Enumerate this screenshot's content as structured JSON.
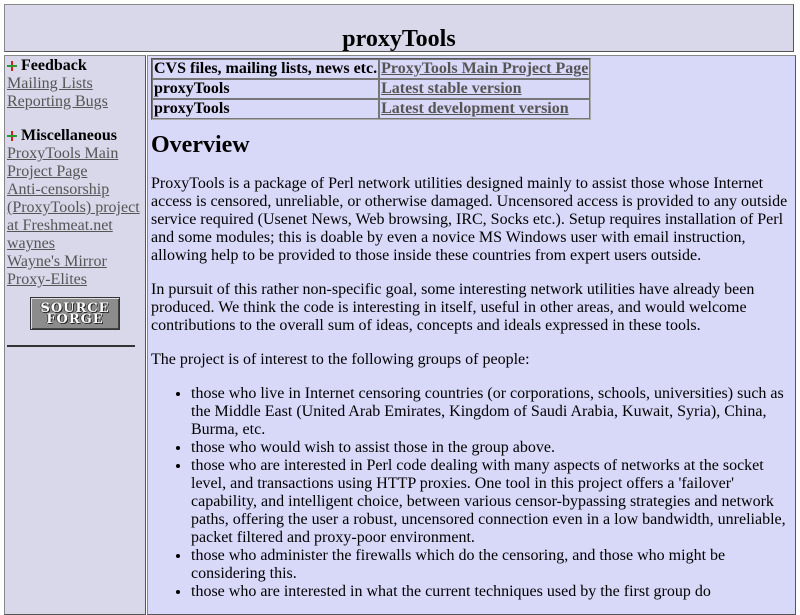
{
  "header": {
    "title": "proxyTools"
  },
  "sidebar": {
    "feedback": {
      "heading": "Feedback",
      "icon": "plus-bullet-icon",
      "links": [
        "Mailing Lists",
        "Reporting Bugs"
      ]
    },
    "misc": {
      "heading": "Miscellaneous",
      "icon": "plus-bullet-icon",
      "links": [
        "ProxyTools Main Project Page",
        "Anti-censorship (ProxyTools) project at Freshmeat.net",
        "waynes",
        "Wayne's Mirror",
        "Proxy-Elites"
      ]
    },
    "logo_text": "SOURCE FORGE"
  },
  "info_table": {
    "rows": [
      {
        "label": "CVS files, mailing lists, news etc.",
        "link": "ProxyTools Main Project Page"
      },
      {
        "label": "proxyTools",
        "link": "Latest stable version"
      },
      {
        "label": "proxyTools",
        "link": "Latest development version"
      }
    ]
  },
  "content": {
    "heading": "Overview",
    "para1": "ProxyTools is a package of Perl network utilities designed mainly to assist those whose Internet access is censored, unreliable, or otherwise damaged. Uncensored access is provided to any outside service required (Usenet News, Web browsing, IRC, Socks etc.). Setup requires installation of Perl and some modules; this is doable by even a novice MS Windows user with email instruction, allowing help to be provided to those inside these countries from expert users outside.",
    "para2": "In pursuit of this rather non-specific goal, some interesting network utilities have already been produced. We think the code is interesting in itself, useful in other areas, and would welcome contributions to the overall sum of ideas, concepts and ideals expressed in these tools.",
    "para3": "The project is of interest to the following groups of people:",
    "bullets": [
      "those who live in Internet censoring countries (or corporations, schools, universities) such as the Middle East (United Arab Emirates, Kingdom of Saudi Arabia, Kuwait, Syria), China, Burma, etc.",
      "those who would wish to assist those in the group above.",
      "those who are interested in Perl code dealing with many aspects of networks at the socket level, and transactions using HTTP proxies. One tool in this project offers a 'failover' capability, and intelligent choice, between various censor-bypassing strategies and network paths, offering the user a robust, uncensored connection even in a low bandwidth, unreliable, packet filtered and proxy-poor environment.",
      "those who administer the firewalls which do the censoring, and those who might be considering this.",
      "those who are interested in what the current techniques used by the first group do"
    ]
  },
  "colors": {
    "panel_bg": "#d8d8ea",
    "main_bg": "#d8d8f8",
    "link": "#555555"
  }
}
